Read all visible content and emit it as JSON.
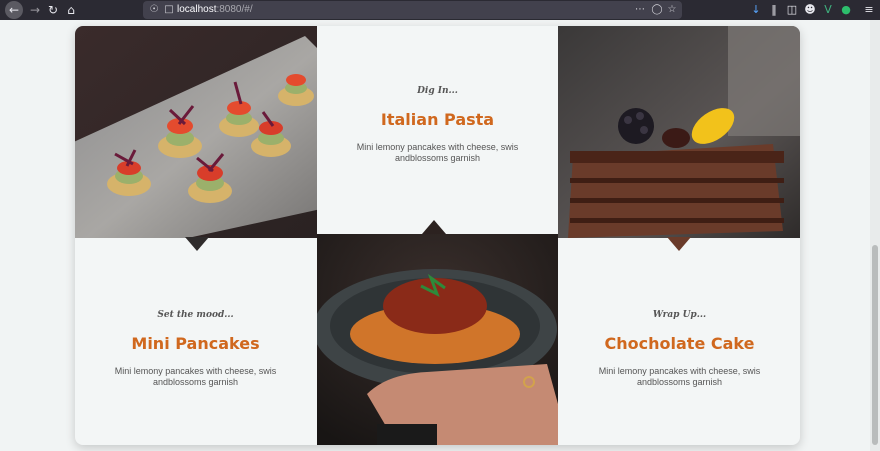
{
  "browser": {
    "nav": {
      "back_icon": "arrow-left",
      "forward_icon": "arrow-right",
      "reload_icon": "reload",
      "home_icon": "home"
    },
    "url_host": "localhost",
    "url_rest": ":8080/#/"
  },
  "menu": {
    "items": [
      {
        "subtitle": "Dig In...",
        "title": "Italian Pasta",
        "description": "Mini lemony pancakes with cheese, swis andblossoms garnish"
      },
      {
        "subtitle": "Set the mood...",
        "title": "Mini Pancakes",
        "description": "Mini lemony pancakes with cheese, swis andblossoms garnish"
      },
      {
        "subtitle": "Wrap Up...",
        "title": "Chocholate Cake",
        "description": "Mini lemony pancakes with cheese, swis andblossoms garnish"
      }
    ],
    "images": [
      {
        "name": "canapes-image",
        "icon": "canapes-photo"
      },
      {
        "name": "chocolate-cake-image",
        "icon": "cake-photo"
      },
      {
        "name": "pasta-image",
        "icon": "pasta-photo"
      }
    ]
  },
  "colors": {
    "accent": "#d0681e",
    "card_bg": "#f3f6f6",
    "page_bg": "#f1f4f4",
    "browser_bg": "#2b2a33"
  }
}
